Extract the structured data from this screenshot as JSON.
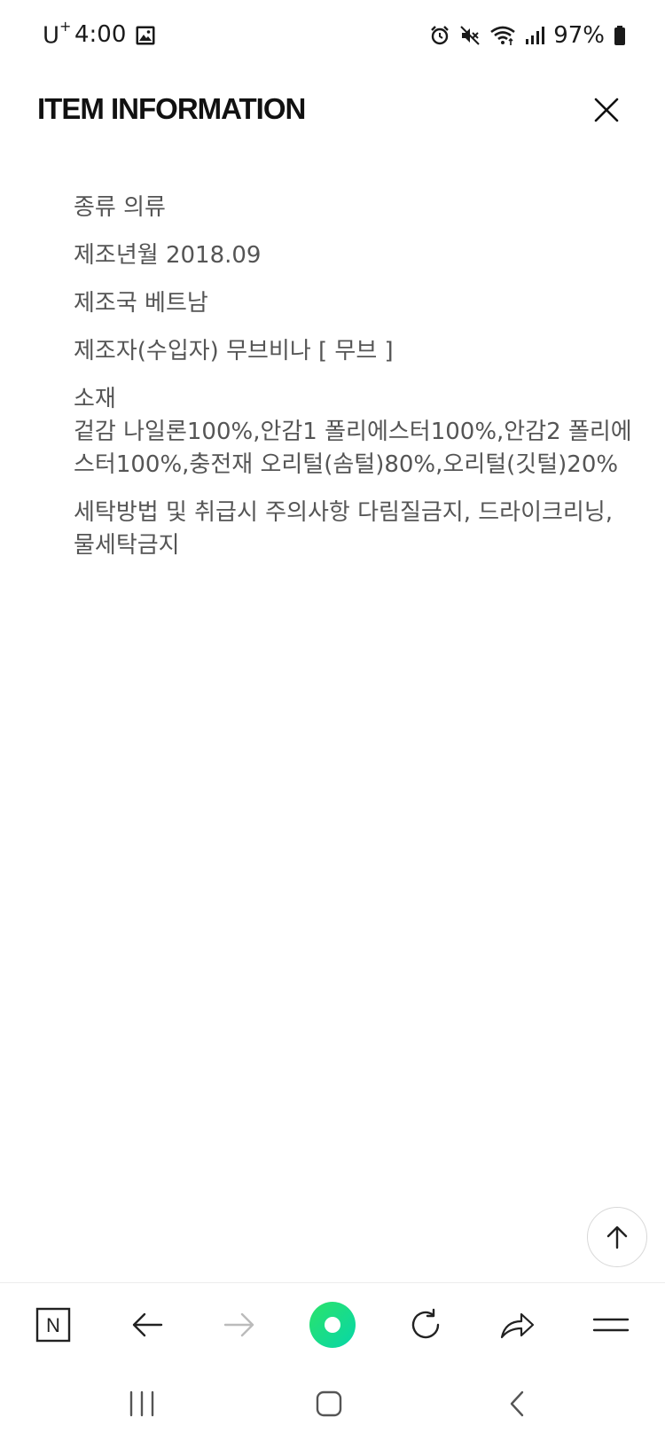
{
  "status_bar": {
    "carrier": "U",
    "carrier_sup": "+",
    "time": "4:00",
    "battery": "97%",
    "icons": [
      "gallery-icon",
      "alarm-icon",
      "mute-icon",
      "wifi-icon",
      "signal-icon",
      "battery-icon"
    ]
  },
  "header": {
    "title": "ITEM INFORMATION",
    "close_icon": "close-icon"
  },
  "info": {
    "items": [
      "종류 의류",
      "제조년월 2018.09",
      "제조국 베트남",
      "제조자(수입자) 무브비나 [ 무브 ]",
      "소재\n겉감 나일론100%,안감1 폴리에스터100%,안감2 폴리에스터100%,충전재 오리털(솜털)80%,오리털(깃털)20%",
      "세탁방법 및 취급시 주의사항 다림질금지, 드라이크리닝, 물세탁금지"
    ]
  },
  "scroll_top": {
    "icon": "arrow-up-icon"
  },
  "toolbar": {
    "n_label": "N",
    "icons": [
      "naver-home-icon",
      "back-arrow-icon",
      "forward-arrow-icon",
      "green-dot-icon",
      "refresh-icon",
      "share-icon",
      "menu-icon"
    ],
    "accent": "#03e06a"
  },
  "android_nav": {
    "icons": [
      "recent-apps-icon",
      "home-icon",
      "back-icon"
    ]
  }
}
